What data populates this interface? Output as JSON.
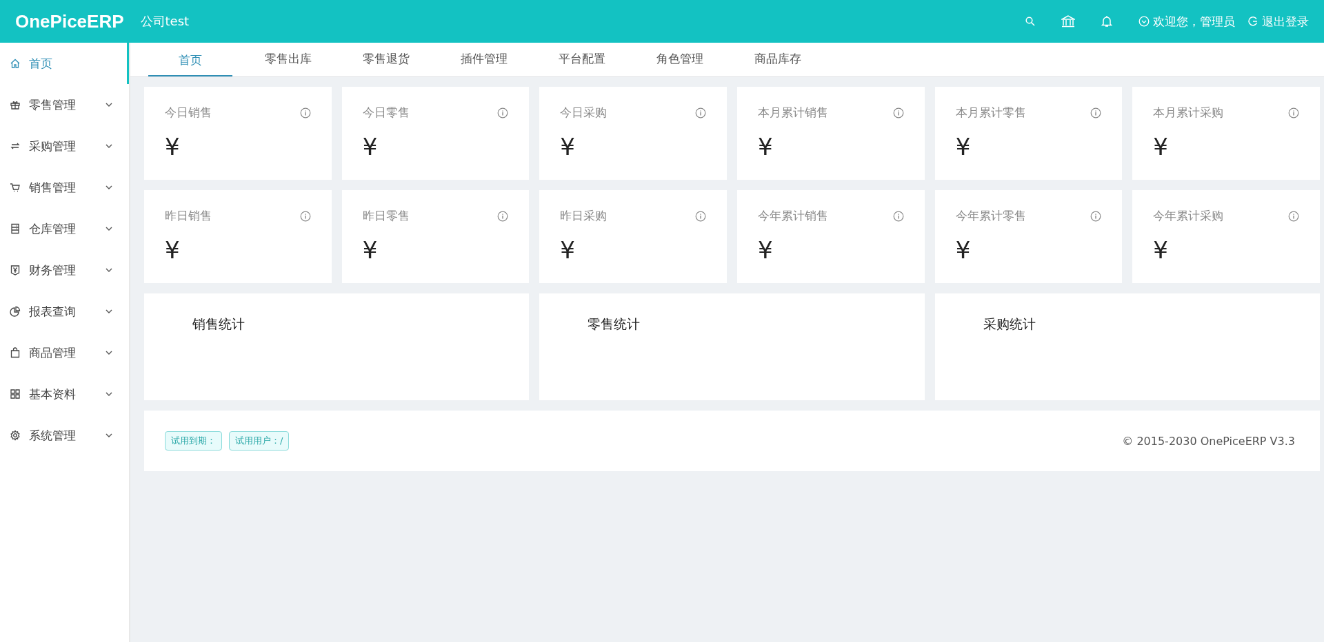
{
  "header": {
    "logo": "OnePiceERP",
    "company": "公司test",
    "welcome": "欢迎您，管理员",
    "logout": "退出登录"
  },
  "sidebar": {
    "items": [
      {
        "label": "首页",
        "selected": true,
        "has_submenu": false
      },
      {
        "label": "零售管理",
        "selected": false,
        "has_submenu": true
      },
      {
        "label": "采购管理",
        "selected": false,
        "has_submenu": true
      },
      {
        "label": "销售管理",
        "selected": false,
        "has_submenu": true
      },
      {
        "label": "仓库管理",
        "selected": false,
        "has_submenu": true
      },
      {
        "label": "财务管理",
        "selected": false,
        "has_submenu": true
      },
      {
        "label": "报表查询",
        "selected": false,
        "has_submenu": true
      },
      {
        "label": "商品管理",
        "selected": false,
        "has_submenu": true
      },
      {
        "label": "基本资料",
        "selected": false,
        "has_submenu": true
      },
      {
        "label": "系统管理",
        "selected": false,
        "has_submenu": true
      }
    ]
  },
  "tabs": [
    {
      "label": "首页",
      "selected": true
    },
    {
      "label": "零售出库",
      "selected": false
    },
    {
      "label": "零售退货",
      "selected": false
    },
    {
      "label": "插件管理",
      "selected": false
    },
    {
      "label": "平台配置",
      "selected": false
    },
    {
      "label": "角色管理",
      "selected": false
    },
    {
      "label": "商品库存",
      "selected": false
    }
  ],
  "stat_cards": [
    {
      "title": "今日销售",
      "value": "¥"
    },
    {
      "title": "今日零售",
      "value": "¥"
    },
    {
      "title": "今日采购",
      "value": "¥"
    },
    {
      "title": "本月累计销售",
      "value": "¥"
    },
    {
      "title": "本月累计零售",
      "value": "¥"
    },
    {
      "title": "本月累计采购",
      "value": "¥"
    },
    {
      "title": "昨日销售",
      "value": "¥"
    },
    {
      "title": "昨日零售",
      "value": "¥"
    },
    {
      "title": "昨日采购",
      "value": "¥"
    },
    {
      "title": "今年累计销售",
      "value": "¥"
    },
    {
      "title": "今年累计零售",
      "value": "¥"
    },
    {
      "title": "今年累计采购",
      "value": "¥"
    }
  ],
  "chart_panels": [
    {
      "title": "销售统计"
    },
    {
      "title": "零售统计"
    },
    {
      "title": "采购统计"
    }
  ],
  "footer": {
    "tags": [
      "试用到期：",
      "试用用户：/"
    ],
    "copyright": "© 2015-2030 OnePiceERP V3.3"
  }
}
